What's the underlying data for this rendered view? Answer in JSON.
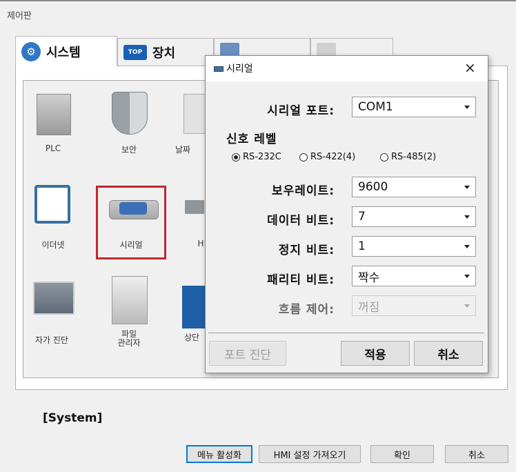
{
  "window": {
    "title": "제어판"
  },
  "tabs": [
    {
      "label": "시스템"
    },
    {
      "label": "장치"
    },
    {
      "label": ""
    },
    {
      "label": ""
    }
  ],
  "icons": [
    {
      "label": "PLC"
    },
    {
      "label": "보안"
    },
    {
      "label": "날짜"
    },
    {
      "label": "이더넷"
    },
    {
      "label": "시리얼"
    },
    {
      "label": "H"
    },
    {
      "label": "자가 진단"
    },
    {
      "label": "파일\n관리자"
    },
    {
      "label": "상단"
    }
  ],
  "status_label": "[System]",
  "bottom_buttons": {
    "menu": "메뉴 활성화",
    "hmi": "HMI 설정 가져오기",
    "ok": "확인",
    "cancel": "취소"
  },
  "dialog": {
    "title": "시리얼",
    "close": "×",
    "serial_port_label": "시리얼 포트:",
    "serial_port_value": "COM1",
    "signal_level_label": "신호 레벨",
    "signal_options": [
      "RS-232C",
      "RS-422(4)",
      "RS-485(2)"
    ],
    "signal_selected": "RS-232C",
    "baud_label": "보우레이트:",
    "baud_value": "9600",
    "databits_label": "데이터 비트:",
    "databits_value": "7",
    "stopbits_label": "정지 비트:",
    "stopbits_value": "1",
    "parity_label": "패리티 비트:",
    "parity_value": "짝수",
    "flow_label": "흐름 제어:",
    "flow_value": "꺼짐",
    "port_diag_button": "포트 진단",
    "apply_button": "적용",
    "cancel_button": "취소"
  }
}
